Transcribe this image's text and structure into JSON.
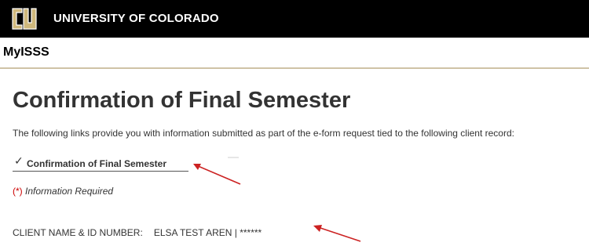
{
  "header": {
    "university_name": "UNIVERSITY OF COLORADO",
    "logo_icon": "cu-logo-icon",
    "background_color": "#000000"
  },
  "app": {
    "name": "MyISSS",
    "divider_color": "#cfc3a6"
  },
  "main": {
    "title": "Confirmation of Final Semester",
    "intro": "The following links provide you with information submitted as part of the e-form request tied to the following client record:",
    "links": [
      {
        "icon": "checkmark-icon",
        "check": "✓",
        "label": "Confirmation of Final Semester"
      }
    ],
    "required_note": {
      "marker": "(*)",
      "text": "Information Required",
      "marker_color": "#cc0000"
    },
    "client": {
      "label": "CLIENT NAME & ID NUMBER:",
      "value": "ELSA TEST AREN | ******"
    }
  },
  "annotations": {
    "arrow_color": "#cc2222",
    "arrow_icon": "red-arrow-icon"
  }
}
